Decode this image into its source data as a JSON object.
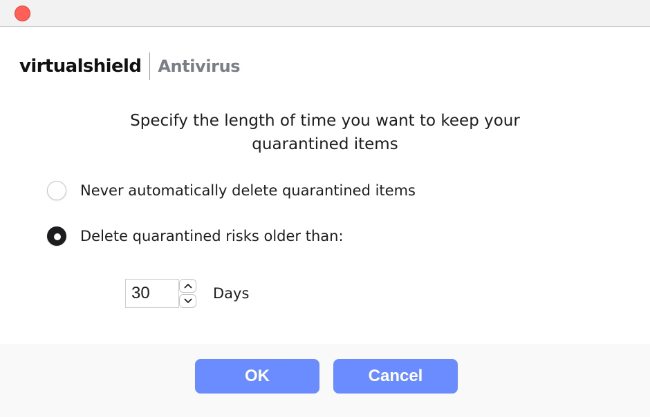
{
  "window": {
    "close_button_color": "#fe5f57"
  },
  "brand": {
    "name": "virtualshield",
    "product": "Antivirus"
  },
  "dialog": {
    "heading": "Specify the length of time you want to keep your quarantined items",
    "options": [
      {
        "label": "Never automatically delete quarantined items",
        "selected": false
      },
      {
        "label": "Delete quarantined risks older than:",
        "selected": true
      }
    ],
    "days": {
      "value": "30",
      "unit_label": "Days",
      "stepper_up_icon": "chevron-up-icon",
      "stepper_down_icon": "chevron-down-icon"
    }
  },
  "buttons": {
    "ok_label": "OK",
    "cancel_label": "Cancel",
    "accent_color": "#6b8cff"
  }
}
